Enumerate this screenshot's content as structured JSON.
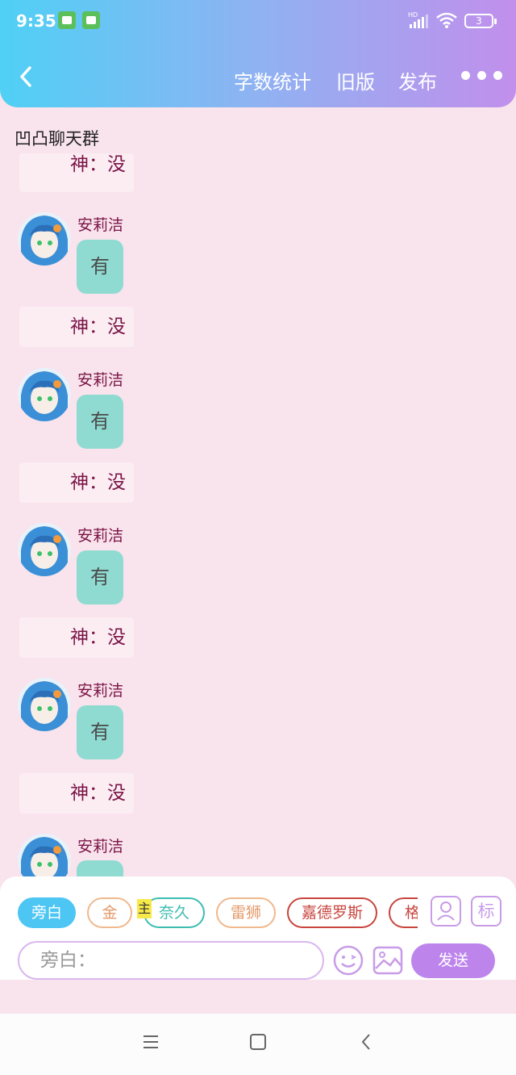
{
  "status_bar": {
    "time": "9:35",
    "signal_label": "HD",
    "battery": "3"
  },
  "header": {
    "actions": [
      "字数统计",
      "旧版",
      "发布"
    ]
  },
  "chat": {
    "title": "凹凸聊天群",
    "messages": [
      {
        "type": "narration",
        "text": "神：没"
      },
      {
        "type": "message",
        "sender": "安莉洁",
        "text": "有"
      },
      {
        "type": "narration",
        "text": "神：没"
      },
      {
        "type": "message",
        "sender": "安莉洁",
        "text": "有"
      },
      {
        "type": "narration",
        "text": "神：没"
      },
      {
        "type": "message",
        "sender": "安莉洁",
        "text": "有"
      },
      {
        "type": "narration",
        "text": "神：没"
      },
      {
        "type": "message",
        "sender": "安莉洁",
        "text": "有"
      },
      {
        "type": "narration",
        "text": "神：没"
      },
      {
        "type": "message",
        "sender": "安莉洁",
        "text": ""
      }
    ]
  },
  "input_panel": {
    "roles": [
      "旁白",
      "金",
      "奈久",
      "雷狮",
      "嘉德罗斯",
      "格"
    ],
    "owner_badge": "主",
    "tag_label": "标",
    "input_placeholder": "旁白：",
    "send_label": "发送"
  },
  "colors": {
    "header_gradient_start": "#4fd0f5",
    "header_gradient_end": "#c18fec",
    "background": "#f9e3ec",
    "bubble": "#8fdbd2",
    "accent_purple": "#bd85ec",
    "name_color": "#7a1446"
  }
}
